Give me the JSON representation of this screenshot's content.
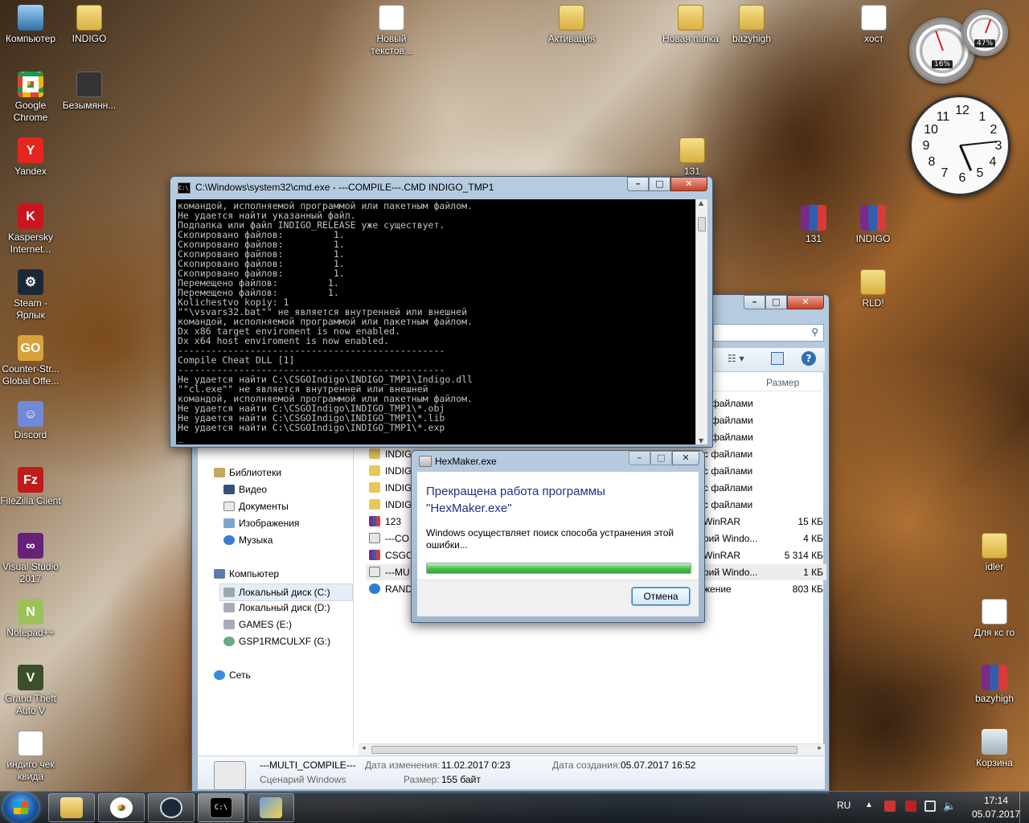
{
  "desktop": {
    "icons": [
      {
        "label": "Компьютер"
      },
      {
        "label": "INDIGO"
      },
      {
        "label": "Новый текстов..."
      },
      {
        "label": "Активация"
      },
      {
        "label": "Новая папка"
      },
      {
        "label": "bazyhigh"
      },
      {
        "label": "хост"
      },
      {
        "label": "Google Chrome"
      },
      {
        "label": "Безымянн..."
      },
      {
        "label": "Yandex"
      },
      {
        "label": "131"
      },
      {
        "label": "Kaspersky Internet..."
      },
      {
        "label": "131"
      },
      {
        "label": "INDIGO"
      },
      {
        "label": "Steam - Ярлык"
      },
      {
        "label": "RLD!"
      },
      {
        "label": "Counter-Str... Global Offe..."
      },
      {
        "label": "Discord"
      },
      {
        "label": "FileZilla Client"
      },
      {
        "label": "Visual Studio 2017"
      },
      {
        "label": "idler"
      },
      {
        "label": "Notepad++"
      },
      {
        "label": "Для кс го"
      },
      {
        "label": "Grand Theft Auto V"
      },
      {
        "label": "bazyhigh"
      },
      {
        "label": "индиго чек квида"
      },
      {
        "label": "Корзина"
      }
    ]
  },
  "gadgets": {
    "cpu_percent": "16%",
    "mem_percent": "47%",
    "clock_numbers": [
      "12",
      "1",
      "2",
      "3",
      "4",
      "5",
      "6",
      "7",
      "8",
      "9",
      "10",
      "11"
    ]
  },
  "cmd": {
    "title": "C:\\Windows\\system32\\cmd.exe - ---COMPILE---.CMD   INDIGO_TMP1",
    "icon_text": "C:\\",
    "lines": [
      "командой, исполняемой программой или пакетным файлом.",
      "Не удается найти указанный файл.",
      "Подпапка или файл INDIGO_RELEASE уже существует.",
      "Скопировано файлов:         1.",
      "Скопировано файлов:         1.",
      "Скопировано файлов:         1.",
      "Скопировано файлов:         1.",
      "Скопировано файлов:         1.",
      "Перемещено файлов:         1.",
      "Перемещено файлов:         1.",
      "Kolichestvo kopiy: 1",
      "\"\"\\vsvars32.bat\"\" не является внутренней или внешней",
      "командой, исполняемой программой или пакетным файлом.",
      "Dx x86 target enviroment is now enabled.",
      "Dx x64 host enviroment is now enabled.",
      "------------------------------------------------",
      "Compile Cheat DLL [1]",
      "------------------------------------------------",
      "Не удается найти C:\\CSGOIndigo\\INDIGO_TMP1\\Indigo.dll",
      "\"\"cl.exe\"\" не является внутренней или внешней",
      "командой, исполняемой программой или пакетным файлом.",
      "Не удается найти C:\\CSGOIndigo\\INDIGO_TMP1\\*.obj",
      "Не удается найти C:\\CSGOIndigo\\INDIGO_TMP1\\*.lib",
      "Не удается найти C:\\CSGOIndigo\\INDIGO_TMP1\\*.exp",
      "_"
    ]
  },
  "explorer": {
    "size_header": "Размер",
    "nav": [
      {
        "label": "Библиотеки"
      },
      {
        "label": "Видео"
      },
      {
        "label": "Документы"
      },
      {
        "label": "Изображения"
      },
      {
        "label": "Музыка"
      },
      {
        "label": "Компьютер"
      },
      {
        "label": "Локальный диск (C:)"
      },
      {
        "label": "Локальный диск (D:)"
      },
      {
        "label": "GAMES (E:)"
      },
      {
        "label": "GSP1RMCULXF (G:)"
      },
      {
        "label": "Сеть"
      }
    ],
    "rows": [
      {
        "name": "",
        "type": "файлами",
        "size": ""
      },
      {
        "name": "",
        "type": "файлами",
        "size": ""
      },
      {
        "name": "",
        "type": "файлами",
        "size": ""
      },
      {
        "name": "INDIG",
        "type": "с файлами",
        "size": ""
      },
      {
        "name": "INDIG",
        "type": "с файлами",
        "size": ""
      },
      {
        "name": "INDIG",
        "type": "с файлами",
        "size": ""
      },
      {
        "name": "INDIG",
        "type": "с файлами",
        "size": ""
      },
      {
        "name": "123",
        "type": "WinRAR",
        "size": "15 КБ"
      },
      {
        "name": "---CO",
        "type": "рий Windo...",
        "size": "4 КБ"
      },
      {
        "name": "CSGO",
        "type": "WinRAR",
        "size": "5 314 КБ"
      },
      {
        "name": "---MU",
        "type": "рий Windo...",
        "size": "1 КБ"
      },
      {
        "name": "RAND",
        "type": "жение",
        "size": "803 КБ"
      }
    ],
    "details": {
      "name": "---MULTI_COMPILE---",
      "kind": "Сценарий Windows",
      "modified_label": "Дата изменения:",
      "modified": "11.02.2017 0:23",
      "created_label": "Дата создания:",
      "created": "05.07.2017 16:52",
      "size_label": "Размер:",
      "size": "155 байт"
    }
  },
  "dialog": {
    "title": "HexMaker.exe",
    "heading": "Прекращена работа программы \"HexMaker.exe\"",
    "message": "Windows осуществляет поиск способа устранения этой ошибки...",
    "progress": 1.0,
    "cancel_label": "Отмена"
  },
  "taskbar": {
    "lang": "RU",
    "time": "17:14",
    "date": "05.07.2017",
    "cmd_icon_text": "C:\\"
  },
  "colors": {
    "accent": "#1a5aa8",
    "dialog_heading": "#1e3287",
    "progress": "#4cc24c"
  }
}
